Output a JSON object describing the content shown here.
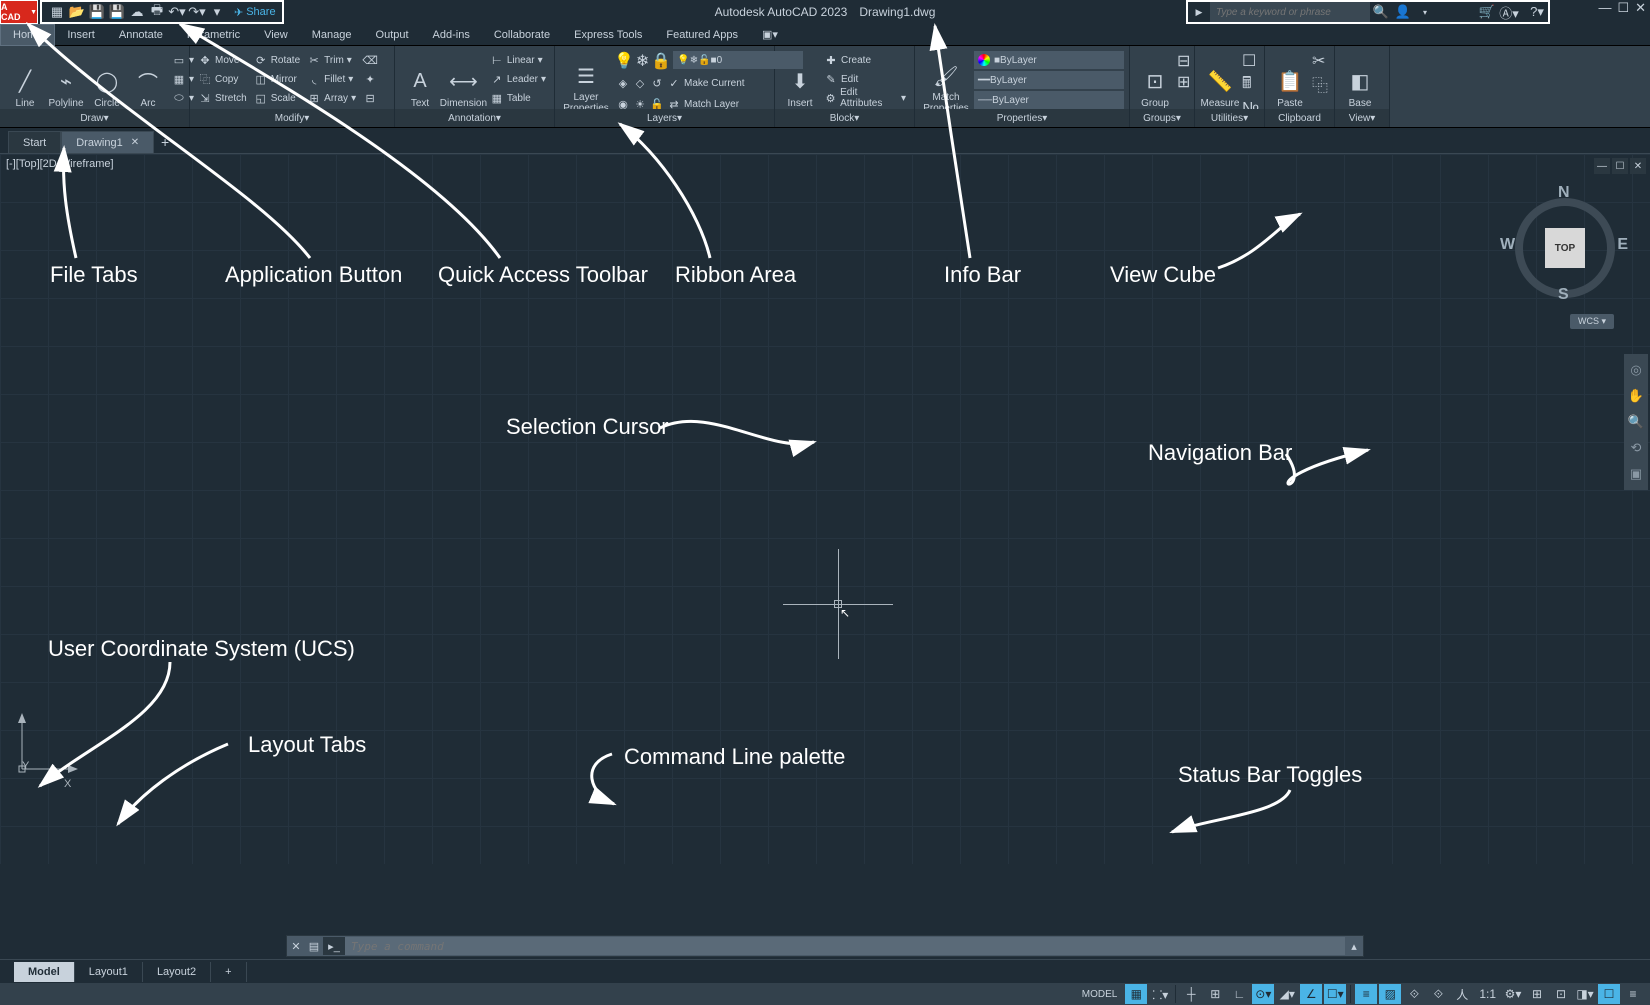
{
  "app_button_text": "A CAD",
  "title": {
    "app": "Autodesk AutoCAD 2023",
    "doc": "Drawing1.dwg"
  },
  "qat": {
    "share": "Share"
  },
  "search": {
    "placeholder": "Type a keyword or phrase"
  },
  "menu": [
    "Home",
    "Insert",
    "Annotate",
    "Parametric",
    "View",
    "Manage",
    "Output",
    "Add-ins",
    "Collaborate",
    "Express Tools",
    "Featured Apps"
  ],
  "ribbon": {
    "draw": {
      "title": "Draw",
      "line": "Line",
      "polyline": "Polyline",
      "circle": "Circle",
      "arc": "Arc"
    },
    "modify": {
      "title": "Modify",
      "move": "Move",
      "rotate": "Rotate",
      "trim": "Trim",
      "copy": "Copy",
      "mirror": "Mirror",
      "fillet": "Fillet",
      "stretch": "Stretch",
      "scale": "Scale",
      "array": "Array"
    },
    "annotation": {
      "title": "Annotation",
      "text": "Text",
      "dimension": "Dimension",
      "linear": "Linear",
      "leader": "Leader",
      "table": "Table"
    },
    "layers": {
      "title": "Layers",
      "props": "Layer\nProperties",
      "current": "0",
      "make_current": "Make Current",
      "match": "Match Layer"
    },
    "block": {
      "title": "Block",
      "insert": "Insert",
      "create": "Create",
      "edit": "Edit",
      "editattr": "Edit Attributes"
    },
    "properties": {
      "title": "Properties",
      "match": "Match\nProperties",
      "bylayer1": "ByLayer",
      "bylayer2": "ByLayer",
      "bylayer3": "ByLayer"
    },
    "groups": {
      "title": "Groups",
      "group": "Group"
    },
    "utilities": {
      "title": "Utilities",
      "measure": "Measure"
    },
    "clipboard": {
      "title": "Clipboard",
      "paste": "Paste"
    },
    "view": {
      "title": "View",
      "base": "Base"
    }
  },
  "filetabs": {
    "start": "Start",
    "drawing": "Drawing1"
  },
  "viewport_label": "[-][Top][2D Wireframe]",
  "viewcube": {
    "top": "TOP",
    "n": "N",
    "s": "S",
    "e": "E",
    "w": "W",
    "wcs": "WCS ▾"
  },
  "cmdline": {
    "placeholder": "Type a command"
  },
  "layouttabs": {
    "model": "Model",
    "l1": "Layout1",
    "l2": "Layout2"
  },
  "statusbar": {
    "model": "MODEL",
    "scale": "1:1"
  },
  "annotations": {
    "filetabs": "File Tabs",
    "appbtn": "Application Button",
    "qat": "Quick Access Toolbar",
    "ribbon": "Ribbon Area",
    "infobar": "Info Bar",
    "viewcube": "View Cube",
    "cursor": "Selection Cursor",
    "navbar": "Navigation Bar",
    "ucs": "User Coordinate System (UCS)",
    "layout": "Layout Tabs",
    "cmdline": "Command Line palette",
    "status": "Status Bar Toggles"
  }
}
